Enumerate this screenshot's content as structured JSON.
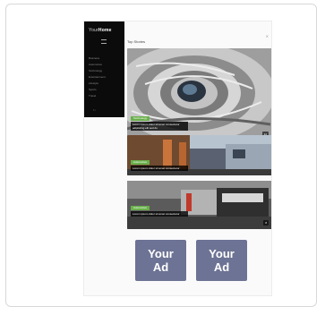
{
  "sidebar": {
    "logo_light": "Your",
    "logo_bold": "Home",
    "items": [
      {
        "label": "Business"
      },
      {
        "label": "Automotive"
      },
      {
        "label": "Technology"
      },
      {
        "label": "Entertainment"
      },
      {
        "label": "Lifestyle"
      },
      {
        "label": "Sports"
      },
      {
        "label": "Travel"
      }
    ],
    "footer": "f  t"
  },
  "main": {
    "section_title": "Top Stories",
    "articles": [
      {
        "tag": "Technology",
        "caption": "Lorem ipsum dolor sit amet consectetur adipiscing elit sed do",
        "badge": "12"
      },
      {
        "tag": "Automotive",
        "caption": "Lorem ipsum dolor sit amet consectetur",
        "badge": "5"
      },
      {
        "tag": "Automotive",
        "caption": "Lorem ipsum dolor sit amet consectetur",
        "badge": "8"
      }
    ]
  },
  "ads": [
    {
      "line1": "Your",
      "line2": "Ad"
    },
    {
      "line1": "Your",
      "line2": "Ad"
    }
  ],
  "colors": {
    "ad_bg": "#6d7394",
    "tag_bg": "#6ab04c",
    "sidebar_bg": "#0b0b0b"
  }
}
